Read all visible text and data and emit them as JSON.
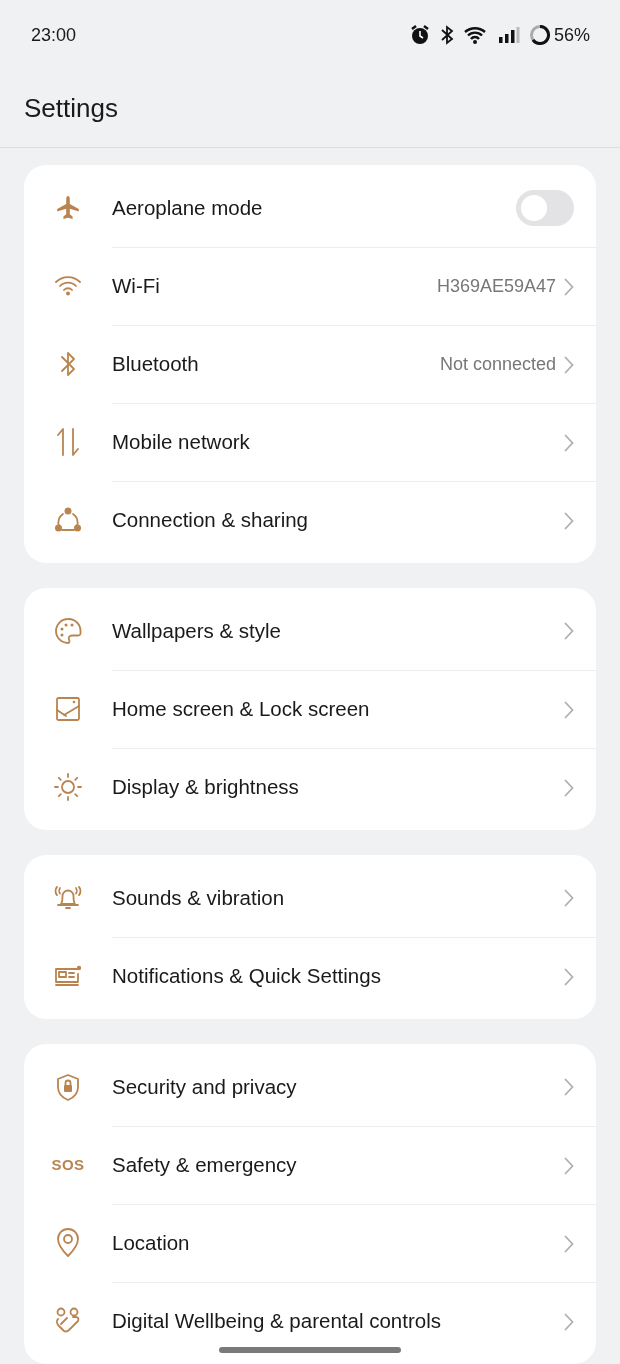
{
  "status_bar": {
    "time": "23:00",
    "battery": "56%"
  },
  "header": {
    "title": "Settings"
  },
  "groups": [
    {
      "items": [
        {
          "label": "Aeroplane mode",
          "kind": "toggle",
          "on": false
        },
        {
          "label": "Wi-Fi",
          "kind": "link",
          "value": "H369AE59A47"
        },
        {
          "label": "Bluetooth",
          "kind": "link",
          "value": "Not connected"
        },
        {
          "label": "Mobile network",
          "kind": "link"
        },
        {
          "label": "Connection & sharing",
          "kind": "link"
        }
      ]
    },
    {
      "items": [
        {
          "label": "Wallpapers & style",
          "kind": "link"
        },
        {
          "label": "Home screen & Lock screen",
          "kind": "link"
        },
        {
          "label": "Display & brightness",
          "kind": "link"
        }
      ]
    },
    {
      "items": [
        {
          "label": "Sounds & vibration",
          "kind": "link"
        },
        {
          "label": "Notifications & Quick Settings",
          "kind": "link"
        }
      ]
    },
    {
      "items": [
        {
          "label": "Security and privacy",
          "kind": "link"
        },
        {
          "icon_text": "SOS",
          "label": "Safety & emergency",
          "kind": "link"
        },
        {
          "label": "Location",
          "kind": "link"
        },
        {
          "label": "Digital Wellbeing & parental controls",
          "kind": "link"
        }
      ]
    }
  ]
}
